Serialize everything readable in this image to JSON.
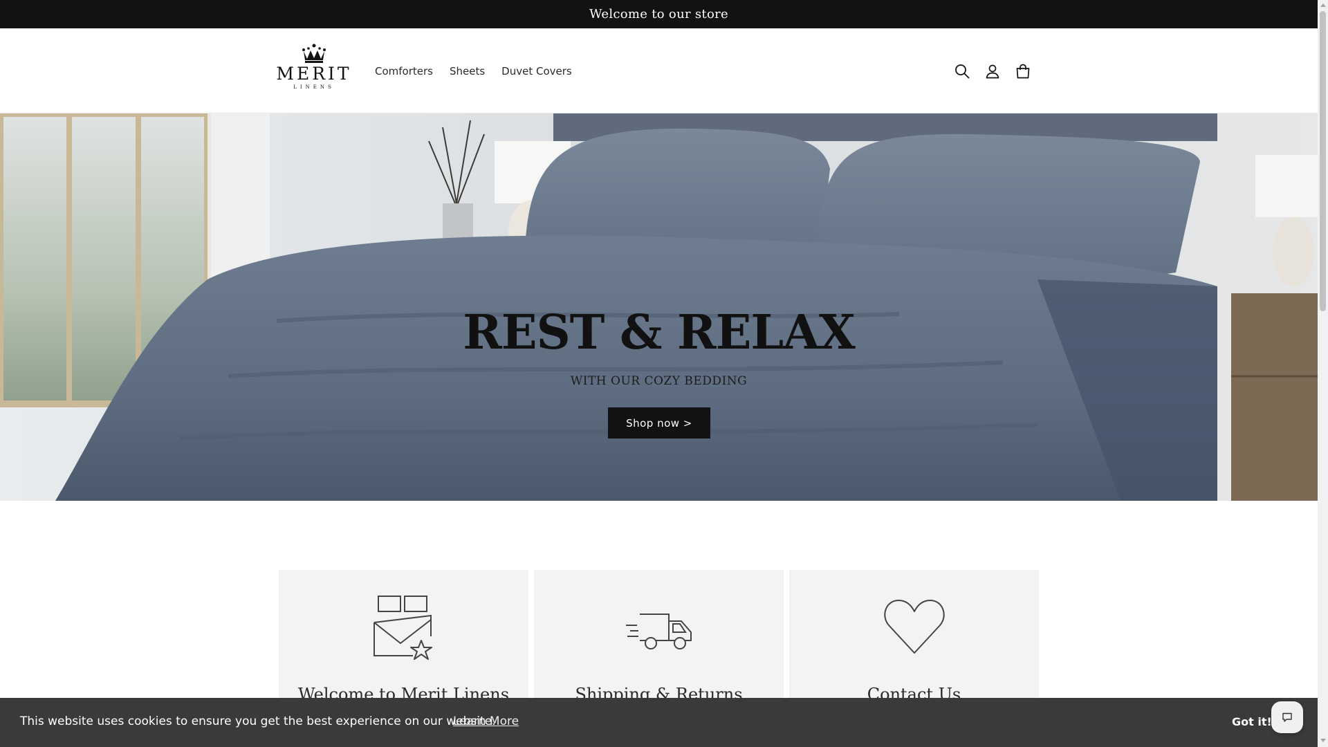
{
  "announcement": {
    "text": "Welcome to our store"
  },
  "header": {
    "logo": {
      "word": "MERIT",
      "sub": "LINENS",
      "icon": "crown-icon"
    },
    "nav": [
      {
        "label": "Comforters"
      },
      {
        "label": "Sheets"
      },
      {
        "label": "Duvet Covers"
      }
    ],
    "icons": [
      "search-icon",
      "account-icon",
      "cart-icon"
    ]
  },
  "hero": {
    "title": "REST & RELAX",
    "subtitle": "WITH OUR COZY BEDDING",
    "button_label": "Shop now >"
  },
  "features": [
    {
      "title": "Welcome to Merit Linens",
      "icon": "bedding-star-icon"
    },
    {
      "title": "Shipping & Returns",
      "icon": "delivery-truck-icon"
    },
    {
      "title": "Contact Us",
      "icon": "heart-icon"
    }
  ],
  "cookie_banner": {
    "message": "This website uses cookies to ensure you get the best experience on our website.",
    "link_label": "Learn More",
    "accept_label": "Got it!"
  },
  "chat": {
    "icon": "chat-bubble-icon"
  },
  "colors": {
    "announcement_bg": "#121212",
    "button_bg": "#121212",
    "bedding": "#5d6c80",
    "feature_bg": "#f3f3f3",
    "cookie_bg": "#3a3a3a"
  }
}
